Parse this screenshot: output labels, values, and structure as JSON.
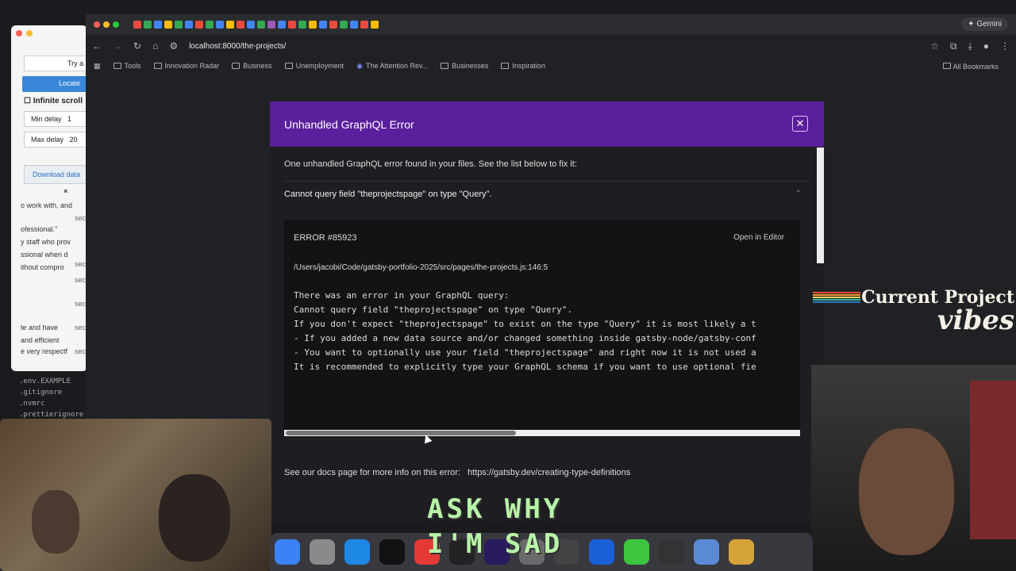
{
  "background_app": {
    "try_button": "Try a",
    "locate_button": "Locate",
    "infinite_scroll": "Infinite scroll",
    "min_delay_label": "Min delay",
    "min_delay_value": "1",
    "max_delay_label": "Max delay",
    "max_delay_value": "20",
    "download_button": "Download data",
    "close_glyph": "×",
    "snippets": [
      "o work with, and",
      "ofessional.\"",
      "y staff who prov",
      "ssional when d",
      "ithout compro",
      "te and have",
      "and efficient",
      "e very respectf"
    ],
    "sec_labels": [
      "sec",
      "sec",
      "sec",
      "sec",
      "sec",
      "sec"
    ]
  },
  "file_tree": [
    ".env.EXAMPLE",
    ".gitignore",
    ".nvmrc",
    ".prettierignore"
  ],
  "browser": {
    "url": "localhost:8000/the-projects/",
    "gemini": "Gemini",
    "bookmarks": [
      "Tools",
      "Innovation Radar",
      "Business",
      "Unemployment",
      "The Attention Rev...",
      "Businesses",
      "Inspiration"
    ],
    "all_bookmarks": "All Bookmarks"
  },
  "modal": {
    "title": "Unhandled GraphQL Error",
    "close_glyph": "✕",
    "intro": "One unhandled GraphQL error found in your files. See the list below to fix it:",
    "accordion_title": "Cannot query field \"theprojectspage\" on type \"Query\".",
    "accordion_chevron": "⌃",
    "error_id": "ERROR #85923",
    "open_in_editor": "Open in Editor",
    "error_path": "/Users/jacobi/Code/gatsby-portfolio-2025/src/pages/the-projects.js:146:5",
    "error_lines": [
      "There was an error in your GraphQL query:",
      "",
      "Cannot query field \"theprojectspage\" on type \"Query\".",
      "",
      "If you don't expect \"theprojectspage\" to exist on the type \"Query\" it is most likely a t",
      "",
      "- If you added a new data source and/or changed something inside gatsby-node/gatsby-conf",
      "- You want to optionally use your field \"theprojectspage\" and right now it is not used a",
      "",
      "It is recommended to explicitly type your GraphQL schema if you want to use optional fie"
    ],
    "docs_text": "See our docs page for more info on this error:",
    "docs_link": "https://gatsby.dev/creating-type-definitions"
  },
  "overlay": {
    "title_line1": "Current Project",
    "title_line2": "vibes",
    "caption_line1": "ASK WHY",
    "caption_line2": "I'M SAD"
  },
  "colors": {
    "modal_header": "#5b1f9d",
    "caption": "#b9f5a8"
  }
}
